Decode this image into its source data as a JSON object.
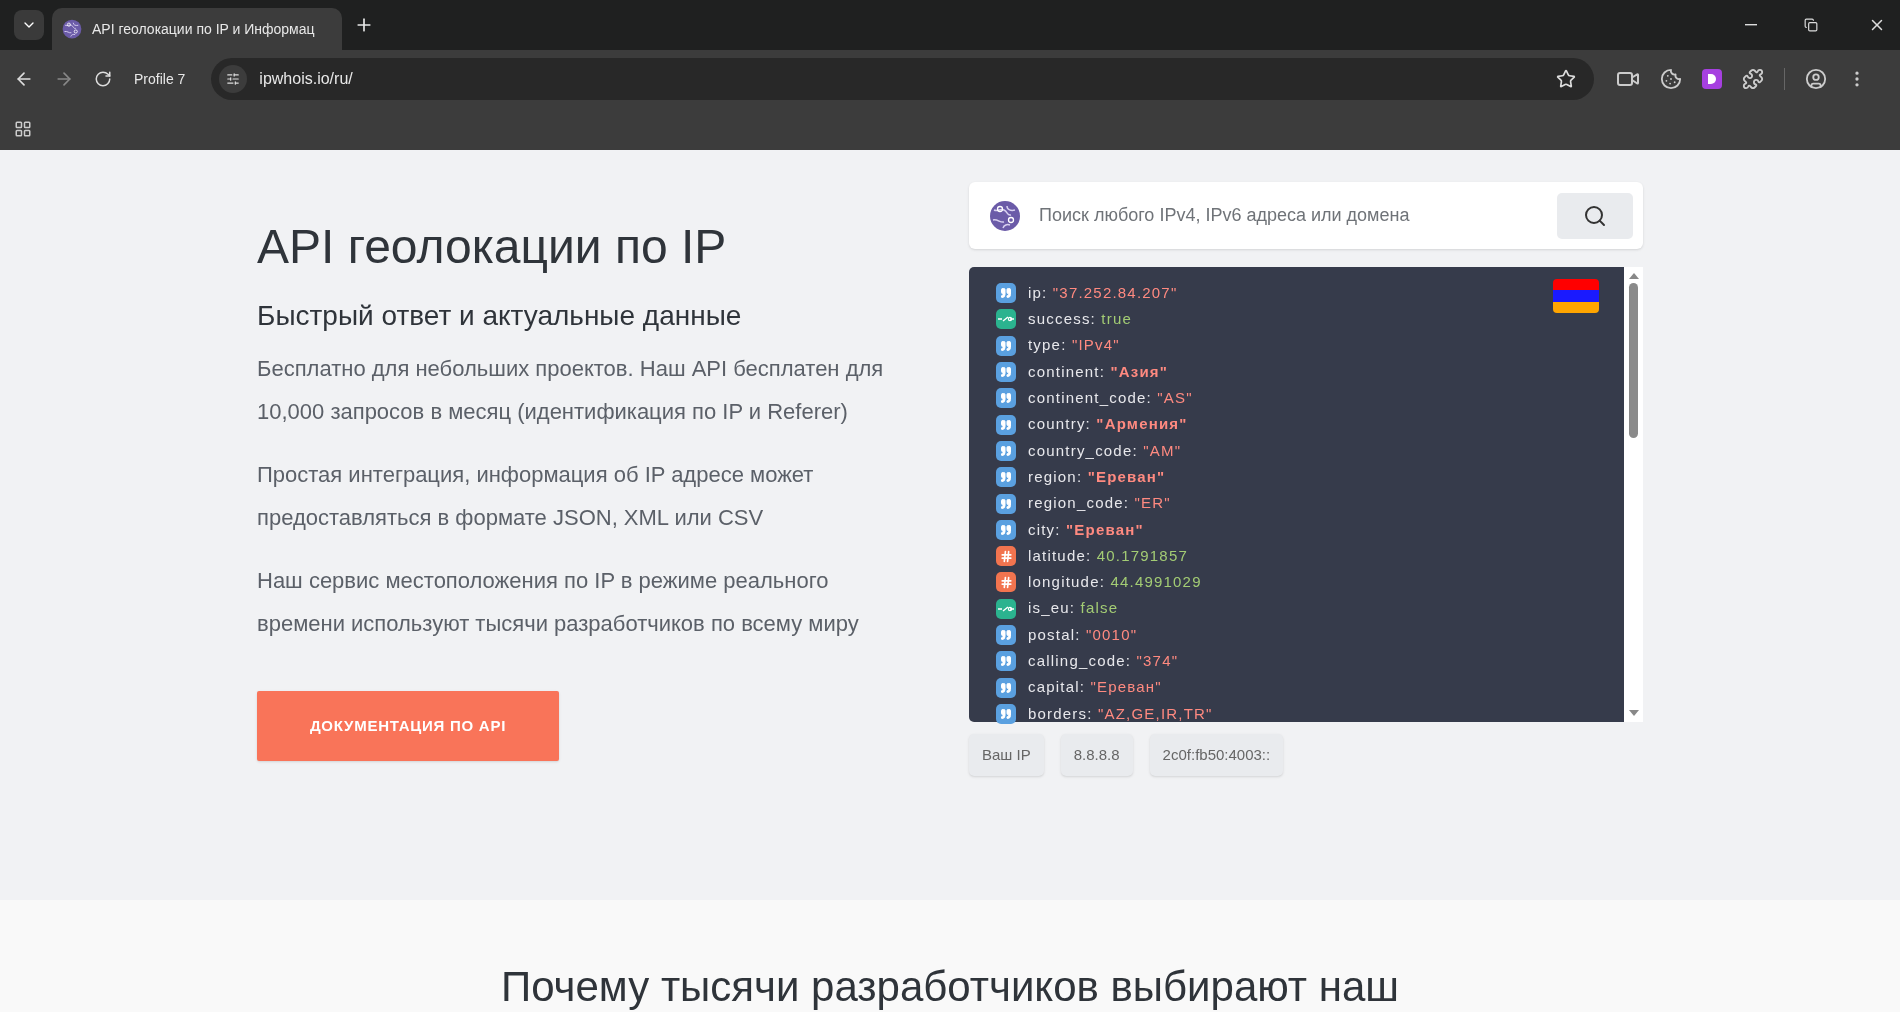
{
  "browser": {
    "tab_title": "API геолокации по IP и Информац",
    "profile": "Profile 7",
    "url": "ipwhois.io/ru/"
  },
  "hero": {
    "title": "API геолокации по IP",
    "subtitle": "Быстрый ответ и актуальные данные",
    "paragraphs": [
      "Бесплатно для небольших проектов. Наш API бесплатен для 10,000 запросов в месяц (идентификация по IP и Referer)",
      "Простая интеграция, информация об IP адресе может предоставляться в формате JSON, XML или CSV",
      "Наш сервис местоположения по IP в режиме реального времени используют тысячи разработчиков по всему миру"
    ],
    "button": "ДОКУМЕНТАЦИЯ ПО API"
  },
  "search": {
    "placeholder": "Поиск любого IPv4, IPv6 адреса или домена"
  },
  "result_rows": [
    {
      "key": "ip:",
      "value": "\"37.252.84.207\"",
      "kind": "string",
      "bold": false
    },
    {
      "key": "success:",
      "value": "true",
      "kind": "boolean",
      "bold": false
    },
    {
      "key": "type:",
      "value": "\"IPv4\"",
      "kind": "string",
      "bold": false
    },
    {
      "key": "continent:",
      "value": "\"Азия\"",
      "kind": "string",
      "bold": true
    },
    {
      "key": "continent_code:",
      "value": "\"AS\"",
      "kind": "string",
      "bold": false
    },
    {
      "key": "country:",
      "value": "\"Армения\"",
      "kind": "string",
      "bold": true
    },
    {
      "key": "country_code:",
      "value": "\"AM\"",
      "kind": "string",
      "bold": false
    },
    {
      "key": "region:",
      "value": "\"Ереван\"",
      "kind": "string",
      "bold": true
    },
    {
      "key": "region_code:",
      "value": "\"ER\"",
      "kind": "string",
      "bold": false
    },
    {
      "key": "city:",
      "value": "\"Ереван\"",
      "kind": "string",
      "bold": true
    },
    {
      "key": "latitude:",
      "value": "40.1791857",
      "kind": "number",
      "bold": false
    },
    {
      "key": "longitude:",
      "value": "44.4991029",
      "kind": "number",
      "bold": false
    },
    {
      "key": "is_eu:",
      "value": "false",
      "kind": "boolean",
      "bold": false
    },
    {
      "key": "postal:",
      "value": "\"0010\"",
      "kind": "string",
      "bold": false
    },
    {
      "key": "calling_code:",
      "value": "\"374\"",
      "kind": "string",
      "bold": false
    },
    {
      "key": "capital:",
      "value": "\"Ереван\"",
      "kind": "string",
      "bold": false
    },
    {
      "key": "borders:",
      "value": "\"AZ,GE,IR,TR\"",
      "kind": "string",
      "bold": false
    }
  ],
  "quick_chips": [
    "Ваш IP",
    "8.8.8.8",
    "2c0f:fb50:4003::"
  ],
  "section_heading": "Почему тысячи разработчиков выбирают наш"
}
